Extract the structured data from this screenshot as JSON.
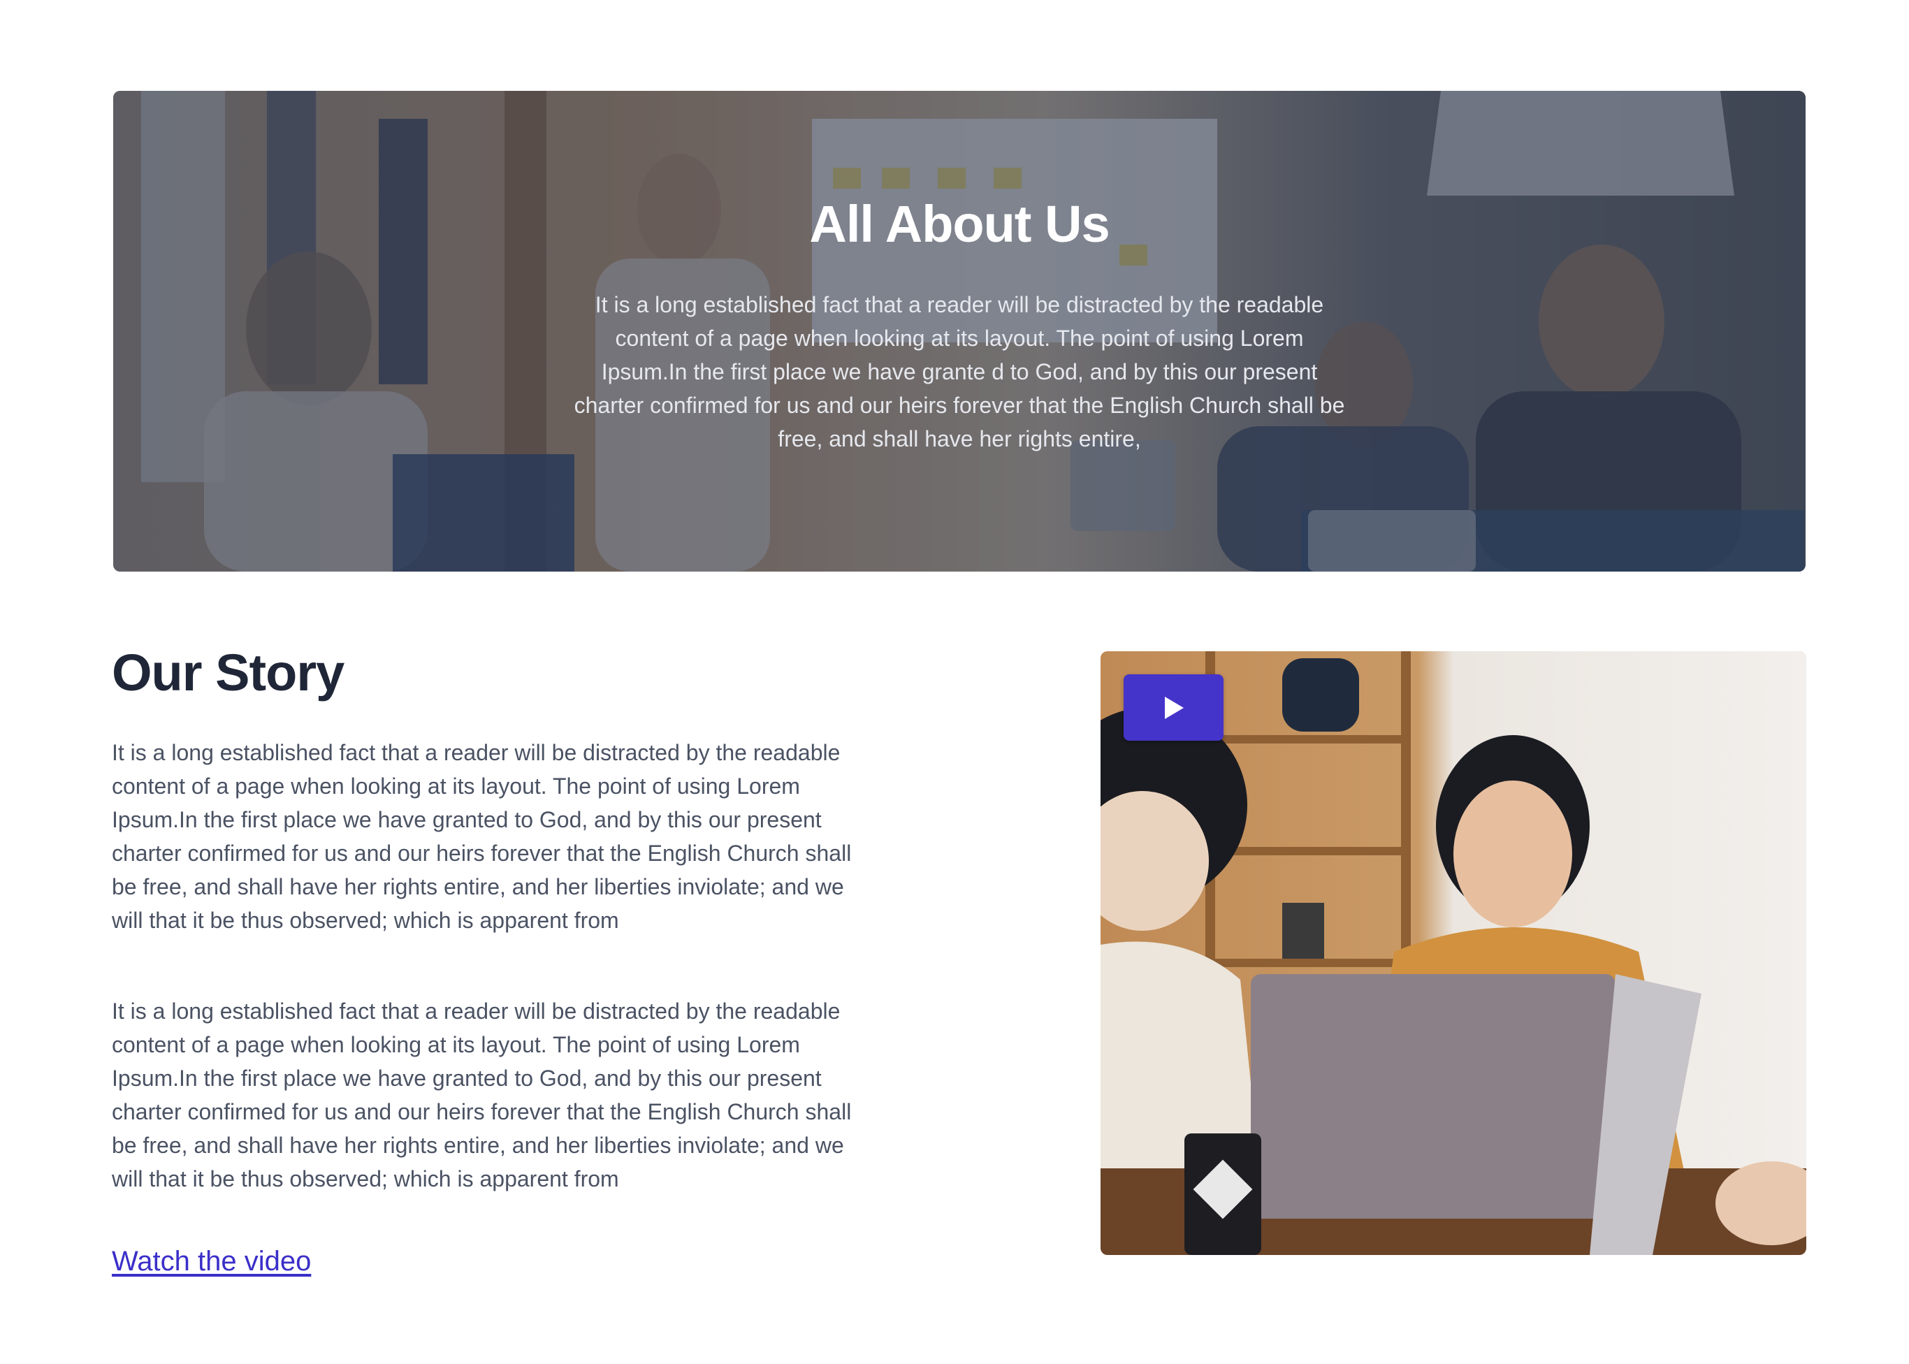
{
  "hero": {
    "title": "All About Us",
    "text": "It is a long established fact that a reader will be distracted by the readable content of a page when looking at its layout. The point of using Lorem Ipsum.In the first place we have grante d to God, and by this our present charter confirmed for us and our heirs forever that the English Church shall be free, and shall have her rights entire,"
  },
  "story": {
    "title": "Our Story",
    "paragraphs": [
      "It is a long established fact that a reader will be distracted by the readable content of a page when looking at its layout. The point of using Lorem Ipsum.In the first place we have granted to God, and by this our present charter confirmed for us and our heirs forever that the English Church shall be free, and shall have her rights entire, and her liberties inviolate; and we will that it be thus observed; which is apparent from",
      "It is a long established fact that a reader will be distracted by the readable content of a page when looking at its layout. The point of using Lorem Ipsum.In the first place we have granted to God, and by this our present charter confirmed for us and our heirs forever that the English Church shall be free, and shall have her rights entire, and her liberties inviolate; and we will that it be thus observed; which is apparent from"
    ],
    "link_label": "Watch the video"
  },
  "video": {
    "play_icon": "play-icon"
  },
  "colors": {
    "heading": "#1f2637",
    "body_text": "#4a5263",
    "link": "#3b2fc9",
    "play_button": "#4534c9",
    "hero_overlay": "#2c344a"
  }
}
